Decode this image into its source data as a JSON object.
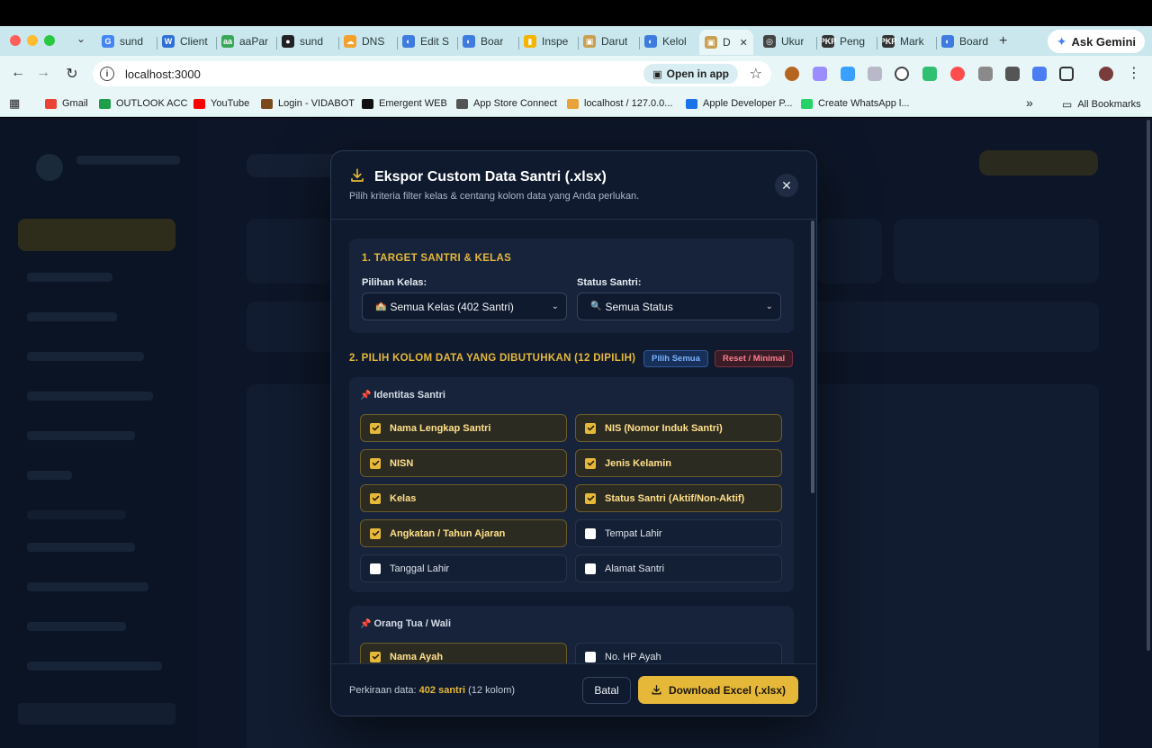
{
  "browser": {
    "tabs": [
      {
        "label": "sund",
        "color": "#4285f4",
        "glyph": "G"
      },
      {
        "label": "Client",
        "color": "#2f6fd9",
        "glyph": "W"
      },
      {
        "label": "aaPar",
        "color": "#3aa657",
        "glyph": "aa"
      },
      {
        "label": "sund",
        "color": "#222222",
        "glyph": "●"
      },
      {
        "label": "DNS",
        "color": "#f4a12c",
        "glyph": "☁"
      },
      {
        "label": "Edit S",
        "color": "#3d7be0",
        "glyph": "◐"
      },
      {
        "label": "Boar",
        "color": "#3d7be0",
        "glyph": "◐"
      },
      {
        "label": "Inspe",
        "color": "#f4b400",
        "glyph": "▮"
      },
      {
        "label": "Darut",
        "color": "#c8a052",
        "glyph": "▣"
      },
      {
        "label": "Kelol",
        "color": "#3d7be0",
        "glyph": "◐"
      },
      {
        "label": "D",
        "color": "#c8a052",
        "glyph": "▣"
      },
      {
        "label": "Ukur",
        "color": "#444444",
        "glyph": "◎"
      },
      {
        "label": "Peng",
        "color": "#333333",
        "glyph": "PKP"
      },
      {
        "label": "Mark",
        "color": "#333333",
        "glyph": "PKP"
      },
      {
        "label": "Board",
        "color": "#3d7be0",
        "glyph": "◐"
      }
    ],
    "new_tab": "+",
    "ask_gemini": "Ask Gemini",
    "url": "localhost:3000",
    "open_in_app": "Open in app",
    "bookmarks": [
      {
        "label": "Gmail",
        "color": "#ea4335"
      },
      {
        "label": "OUTLOOK ACC",
        "color": "#1e9e4a"
      },
      {
        "label": "YouTube",
        "color": "#ff0000"
      },
      {
        "label": "Login - VIDABOT",
        "color": "#7a4a1c"
      },
      {
        "label": "Emergent WEB",
        "color": "#111111"
      },
      {
        "label": "App Store Connect",
        "color": "#555555"
      },
      {
        "label": "localhost / 127.0.0...",
        "color": "#e8a33a"
      },
      {
        "label": "Apple Developer P...",
        "color": "#1a73e8"
      },
      {
        "label": "Create WhatsApp l...",
        "color": "#25d366"
      }
    ],
    "bookmarks_overflow": "»",
    "all_bookmarks": "All Bookmarks"
  },
  "modal": {
    "title": "Ekspor Custom Data Santri (.xlsx)",
    "subtitle": "Pilih kriteria filter kelas & centang kolom data yang Anda perlukan.",
    "close": "✕",
    "section1": {
      "title": "1. TARGET SANTRI & KELAS",
      "class_label": "Pilihan Kelas:",
      "class_value": "Semua Kelas (402 Santri)",
      "class_emoji": "🏫",
      "status_label": "Status Santri:",
      "status_value": "Semua Status",
      "status_emoji": "🔍"
    },
    "section2": {
      "title": "2. PILIH KOLOM DATA YANG DIBUTUHKAN (12 DIPILIH)",
      "select_all": "Pilih Semua",
      "reset": "Reset / Minimal",
      "groups": [
        {
          "title": "Identitas Santri",
          "options": [
            {
              "label": "Nama Lengkap Santri",
              "checked": true
            },
            {
              "label": "NIS (Nomor Induk Santri)",
              "checked": true
            },
            {
              "label": "NISN",
              "checked": true
            },
            {
              "label": "Jenis Kelamin",
              "checked": true
            },
            {
              "label": "Kelas",
              "checked": true
            },
            {
              "label": "Status Santri (Aktif/Non-Aktif)",
              "checked": true
            },
            {
              "label": "Angkatan / Tahun Ajaran",
              "checked": true
            },
            {
              "label": "Tempat Lahir",
              "checked": false
            },
            {
              "label": "Tanggal Lahir",
              "checked": false
            },
            {
              "label": "Alamat Santri",
              "checked": false
            }
          ]
        },
        {
          "title": "Orang Tua / Wali",
          "options": [
            {
              "label": "Nama Ayah",
              "checked": true
            },
            {
              "label": "No. HP Ayah",
              "checked": false
            }
          ]
        }
      ]
    },
    "footer": {
      "estimate_prefix": "Perkiraan data:",
      "estimate_count": "402 santri",
      "estimate_suffix": "(12 kolom)",
      "cancel": "Batal",
      "download": "Download Excel (.xlsx)"
    }
  },
  "colors": {
    "accent": "#e6b83a",
    "modal_bg": "#0f1a2e",
    "page_bg": "#0d1628"
  }
}
